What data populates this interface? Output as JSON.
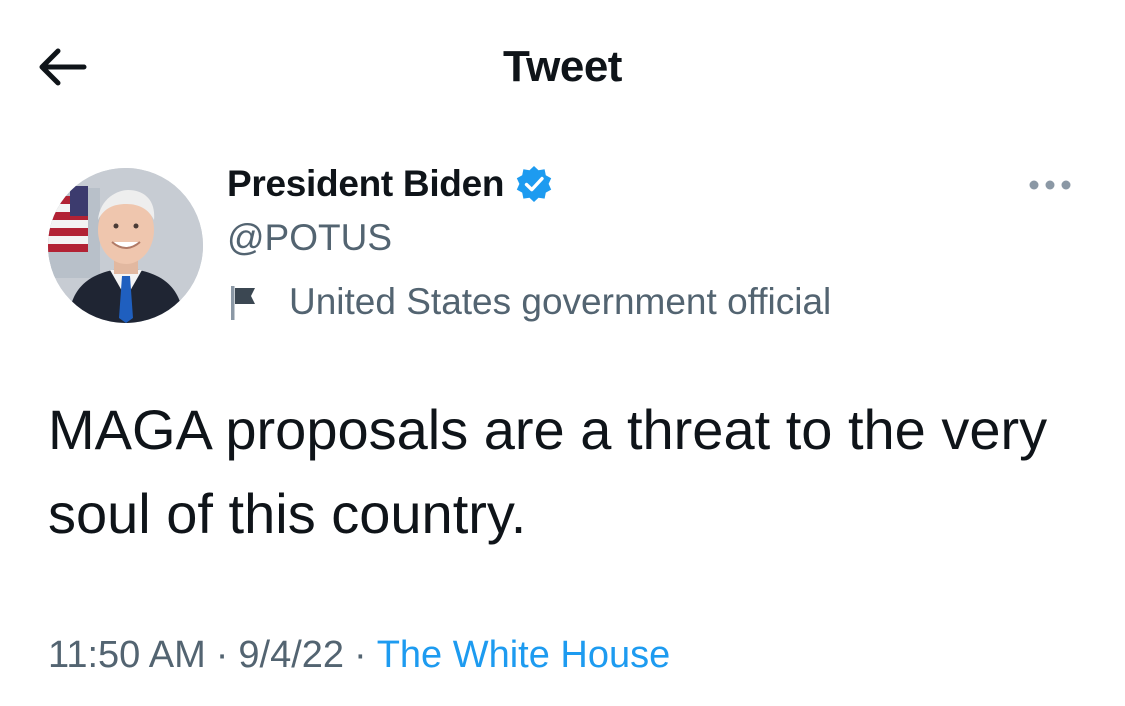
{
  "nav": {
    "title": "Tweet"
  },
  "tweet": {
    "author_name": "President Biden",
    "handle": "@POTUS",
    "affiliation": "United States government official",
    "text": "MAGA proposals are a threat to the very soul of this country.",
    "time": "11:50 AM",
    "separator": "·",
    "date": "9/4/22",
    "source": "The White House"
  },
  "colors": {
    "text_primary": "#0f1419",
    "text_secondary": "#536471",
    "accent": "#1d9bf0"
  },
  "icons": {
    "back": "arrow-left-icon",
    "verified": "verified-badge-icon",
    "affiliation": "flag-icon",
    "more": "more-horizontal-icon"
  }
}
